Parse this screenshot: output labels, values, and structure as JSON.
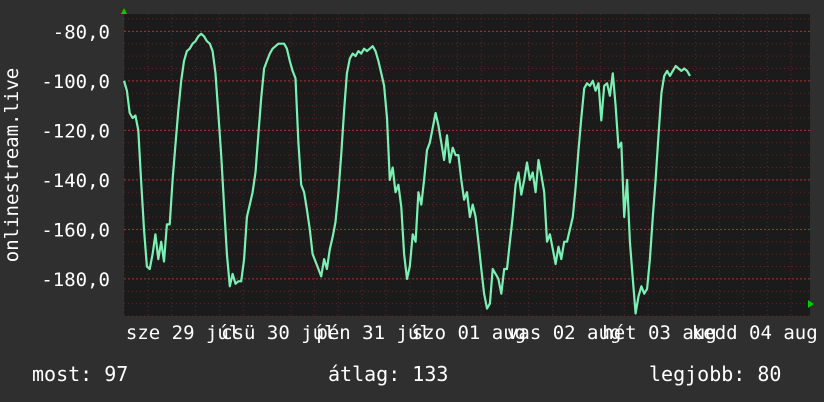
{
  "chart_data": {
    "type": "line",
    "ylabel": "onlinestream.live",
    "ylim": [
      -195,
      -73
    ],
    "yticks": [
      {
        "value": -80,
        "label": "-80,0"
      },
      {
        "value": -100,
        "label": "-100,0"
      },
      {
        "value": -120,
        "label": "-120,0"
      },
      {
        "value": -140,
        "label": "-140,0"
      },
      {
        "value": -160,
        "label": "-160,0"
      },
      {
        "value": -180,
        "label": "-180,0"
      }
    ],
    "xlim": [
      0,
      7.2
    ],
    "xticks": [
      {
        "value": 0.62,
        "label": "sze 29 júl"
      },
      {
        "value": 1.62,
        "label": "csü 30 júl"
      },
      {
        "value": 2.62,
        "label": "pén 31 júl"
      },
      {
        "value": 3.62,
        "label": "szo 01 aug"
      },
      {
        "value": 4.62,
        "label": "vas 02 aug"
      },
      {
        "value": 5.62,
        "label": "hét 03 aug"
      },
      {
        "value": 6.62,
        "label": "kedd 04 aug"
      }
    ],
    "grid": true,
    "colors": {
      "line": "#7af0b4",
      "grid": "#b03030",
      "background": "#1b1b1b",
      "axis_arrow": "#00cc00"
    },
    "series": [
      {
        "values": [
          [
            0.0,
            -100
          ],
          [
            0.03,
            -104
          ],
          [
            0.06,
            -113
          ],
          [
            0.09,
            -115
          ],
          [
            0.12,
            -114
          ],
          [
            0.15,
            -120
          ],
          [
            0.18,
            -141
          ],
          [
            0.21,
            -160
          ],
          [
            0.24,
            -175
          ],
          [
            0.27,
            -176
          ],
          [
            0.3,
            -170
          ],
          [
            0.33,
            -162
          ],
          [
            0.36,
            -172
          ],
          [
            0.39,
            -165
          ],
          [
            0.42,
            -173
          ],
          [
            0.45,
            -158
          ],
          [
            0.48,
            -158
          ],
          [
            0.51,
            -140
          ],
          [
            0.54,
            -126
          ],
          [
            0.57,
            -112
          ],
          [
            0.6,
            -100
          ],
          [
            0.63,
            -92
          ],
          [
            0.66,
            -88
          ],
          [
            0.69,
            -87
          ],
          [
            0.72,
            -85
          ],
          [
            0.75,
            -84
          ],
          [
            0.78,
            -82
          ],
          [
            0.81,
            -81
          ],
          [
            0.84,
            -82
          ],
          [
            0.87,
            -84
          ],
          [
            0.9,
            -85
          ],
          [
            0.93,
            -88
          ],
          [
            0.96,
            -97
          ],
          [
            0.99,
            -113
          ],
          [
            1.02,
            -130
          ],
          [
            1.05,
            -150
          ],
          [
            1.08,
            -170
          ],
          [
            1.11,
            -183
          ],
          [
            1.14,
            -178
          ],
          [
            1.17,
            -182
          ],
          [
            1.2,
            -181
          ],
          [
            1.23,
            -181
          ],
          [
            1.26,
            -172
          ],
          [
            1.29,
            -155
          ],
          [
            1.32,
            -150
          ],
          [
            1.35,
            -145
          ],
          [
            1.38,
            -137
          ],
          [
            1.41,
            -122
          ],
          [
            1.44,
            -107
          ],
          [
            1.47,
            -95
          ],
          [
            1.5,
            -92
          ],
          [
            1.53,
            -89
          ],
          [
            1.56,
            -87
          ],
          [
            1.59,
            -86
          ],
          [
            1.62,
            -85
          ],
          [
            1.65,
            -85
          ],
          [
            1.68,
            -85
          ],
          [
            1.71,
            -87
          ],
          [
            1.74,
            -92
          ],
          [
            1.77,
            -96
          ],
          [
            1.8,
            -99
          ],
          [
            1.83,
            -125
          ],
          [
            1.86,
            -142
          ],
          [
            1.89,
            -145
          ],
          [
            1.92,
            -152
          ],
          [
            1.95,
            -160
          ],
          [
            1.98,
            -170
          ],
          [
            2.01,
            -173
          ],
          [
            2.04,
            -176
          ],
          [
            2.07,
            -179
          ],
          [
            2.1,
            -172
          ],
          [
            2.13,
            -176
          ],
          [
            2.16,
            -168
          ],
          [
            2.19,
            -163
          ],
          [
            2.22,
            -157
          ],
          [
            2.25,
            -145
          ],
          [
            2.28,
            -130
          ],
          [
            2.31,
            -112
          ],
          [
            2.34,
            -97
          ],
          [
            2.37,
            -91
          ],
          [
            2.4,
            -89
          ],
          [
            2.43,
            -90
          ],
          [
            2.46,
            -88
          ],
          [
            2.49,
            -89
          ],
          [
            2.52,
            -87
          ],
          [
            2.55,
            -88
          ],
          [
            2.58,
            -87
          ],
          [
            2.61,
            -86
          ],
          [
            2.64,
            -88
          ],
          [
            2.67,
            -92
          ],
          [
            2.7,
            -97
          ],
          [
            2.73,
            -102
          ],
          [
            2.76,
            -115
          ],
          [
            2.79,
            -140
          ],
          [
            2.82,
            -135
          ],
          [
            2.85,
            -145
          ],
          [
            2.88,
            -142
          ],
          [
            2.91,
            -151
          ],
          [
            2.94,
            -170
          ],
          [
            2.97,
            -180
          ],
          [
            3.0,
            -175
          ],
          [
            3.03,
            -162
          ],
          [
            3.06,
            -165
          ],
          [
            3.09,
            -145
          ],
          [
            3.12,
            -150
          ],
          [
            3.15,
            -140
          ],
          [
            3.18,
            -128
          ],
          [
            3.21,
            -125
          ],
          [
            3.24,
            -119
          ],
          [
            3.27,
            -113
          ],
          [
            3.3,
            -118
          ],
          [
            3.33,
            -125
          ],
          [
            3.36,
            -132
          ],
          [
            3.39,
            -122
          ],
          [
            3.42,
            -133
          ],
          [
            3.45,
            -127
          ],
          [
            3.48,
            -130
          ],
          [
            3.51,
            -130
          ],
          [
            3.54,
            -140
          ],
          [
            3.57,
            -148
          ],
          [
            3.6,
            -145
          ],
          [
            3.63,
            -155
          ],
          [
            3.66,
            -150
          ],
          [
            3.69,
            -155
          ],
          [
            3.72,
            -165
          ],
          [
            3.75,
            -176
          ],
          [
            3.78,
            -186
          ],
          [
            3.81,
            -192
          ],
          [
            3.84,
            -190
          ],
          [
            3.87,
            -176
          ],
          [
            3.9,
            -178
          ],
          [
            3.93,
            -180
          ],
          [
            3.96,
            -186
          ],
          [
            3.99,
            -176
          ],
          [
            4.02,
            -176
          ],
          [
            4.05,
            -165
          ],
          [
            4.08,
            -155
          ],
          [
            4.11,
            -142
          ],
          [
            4.14,
            -137
          ],
          [
            4.17,
            -146
          ],
          [
            4.2,
            -140
          ],
          [
            4.23,
            -133
          ],
          [
            4.26,
            -140
          ],
          [
            4.29,
            -137
          ],
          [
            4.32,
            -145
          ],
          [
            4.35,
            -132
          ],
          [
            4.38,
            -138
          ],
          [
            4.41,
            -145
          ],
          [
            4.44,
            -165
          ],
          [
            4.47,
            -162
          ],
          [
            4.5,
            -168
          ],
          [
            4.53,
            -174
          ],
          [
            4.56,
            -167
          ],
          [
            4.59,
            -172
          ],
          [
            4.62,
            -165
          ],
          [
            4.65,
            -165
          ],
          [
            4.68,
            -160
          ],
          [
            4.71,
            -155
          ],
          [
            4.74,
            -143
          ],
          [
            4.77,
            -128
          ],
          [
            4.8,
            -115
          ],
          [
            4.83,
            -103
          ],
          [
            4.86,
            -101
          ],
          [
            4.89,
            -102
          ],
          [
            4.92,
            -100
          ],
          [
            4.95,
            -104
          ],
          [
            4.98,
            -101
          ],
          [
            5.01,
            -116
          ],
          [
            5.04,
            -102
          ],
          [
            5.07,
            -101
          ],
          [
            5.1,
            -106
          ],
          [
            5.13,
            -97
          ],
          [
            5.16,
            -110
          ],
          [
            5.19,
            -127
          ],
          [
            5.22,
            -125
          ],
          [
            5.25,
            -155
          ],
          [
            5.28,
            -140
          ],
          [
            5.31,
            -165
          ],
          [
            5.34,
            -180
          ],
          [
            5.37,
            -194
          ],
          [
            5.4,
            -187
          ],
          [
            5.43,
            -183
          ],
          [
            5.46,
            -186
          ],
          [
            5.49,
            -184
          ],
          [
            5.52,
            -172
          ],
          [
            5.55,
            -155
          ],
          [
            5.58,
            -140
          ],
          [
            5.61,
            -122
          ],
          [
            5.64,
            -105
          ],
          [
            5.67,
            -98
          ],
          [
            5.7,
            -96
          ],
          [
            5.73,
            -98
          ],
          [
            5.76,
            -96
          ],
          [
            5.79,
            -94
          ],
          [
            5.82,
            -95
          ],
          [
            5.85,
            -96
          ],
          [
            5.88,
            -95
          ],
          [
            5.91,
            -96
          ],
          [
            5.94,
            -98
          ]
        ]
      }
    ]
  },
  "stats": {
    "now": "most: 97",
    "avg": "átlag: 133",
    "best": "legjobb: 80"
  }
}
